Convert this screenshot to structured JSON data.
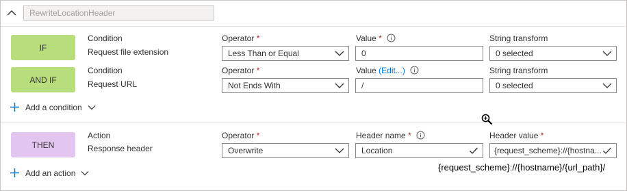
{
  "rule": {
    "name_placeholder": "RewriteLocationHeader"
  },
  "conditions": [
    {
      "pill": "IF",
      "label": "Condition",
      "type": "Request file extension",
      "operator_label": "Operator",
      "operator_value": "Less Than or Equal",
      "value_label": "Value",
      "value_value": "0",
      "transform_label": "String transform",
      "transform_value": "0 selected"
    },
    {
      "pill": "AND IF",
      "label": "Condition",
      "type": "Request URL",
      "operator_label": "Operator",
      "operator_value": "Not Ends With",
      "value_label": "Value",
      "value_edit": "(Edit...)",
      "value_value": "/",
      "transform_label": "String transform",
      "transform_value": "0 selected"
    }
  ],
  "add_condition": "Add a condition",
  "action": {
    "pill": "THEN",
    "label": "Action",
    "type": "Response header",
    "operator_label": "Operator",
    "operator_value": "Overwrite",
    "header_name_label": "Header name",
    "header_name_value": "Location",
    "header_value_label": "Header value",
    "header_value_value": "{request_scheme}://{hostna..."
  },
  "add_action": "Add an action",
  "tooltip_text": "{request_scheme}://{hostname}/{url_path}/",
  "required_mark": "*",
  "colors": {
    "accent": "#0078d4",
    "if_pill": "#b8dd7c",
    "then_pill": "#e3c6ef",
    "required": "#a4262c"
  }
}
